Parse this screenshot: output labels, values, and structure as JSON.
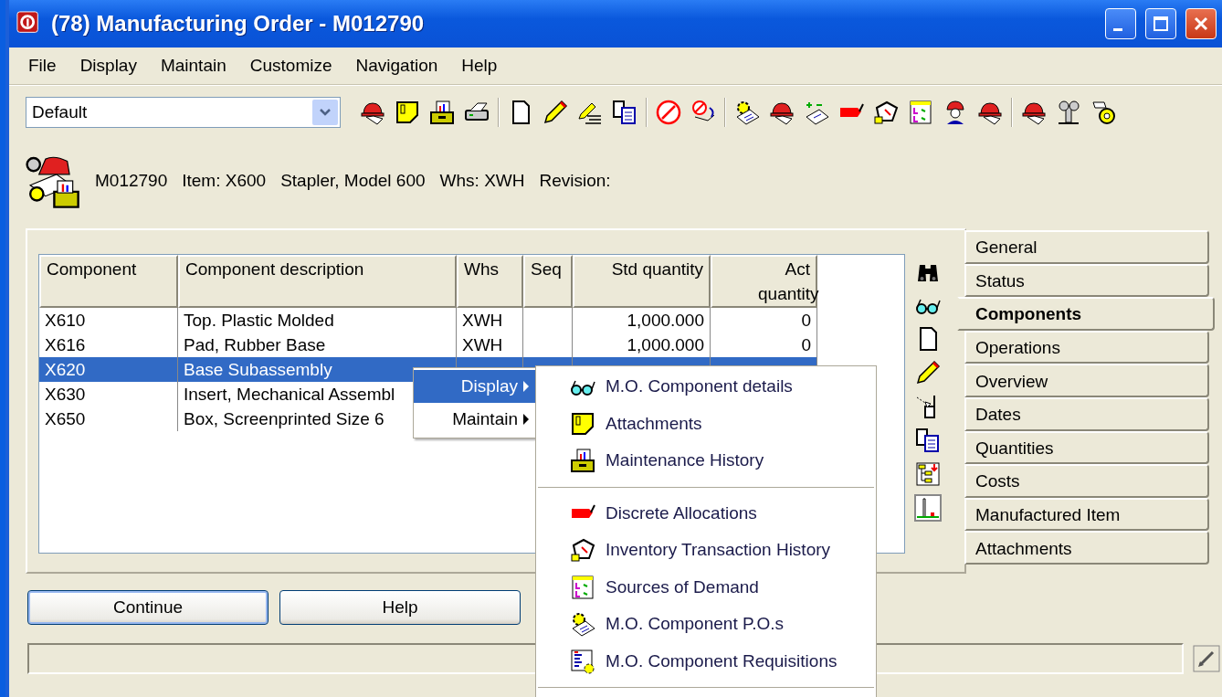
{
  "window": {
    "title": "(78) Manufacturing Order - M012790"
  },
  "menu_bar": [
    "File",
    "Display",
    "Maintain",
    "Customize",
    "Navigation",
    "Help"
  ],
  "view_select": {
    "value": "Default"
  },
  "header": {
    "order": "M012790",
    "item": "Item: X600",
    "description": "Stapler, Model 600",
    "warehouse": "Whs: XWH",
    "revision": "Revision:"
  },
  "table": {
    "columns": [
      "Component",
      "Component description",
      "Whs",
      "Seq",
      "Std quantity",
      "Act quantity"
    ],
    "rows": [
      {
        "cells": [
          "X610",
          "Top. Plastic Molded",
          "XWH",
          "",
          "1,000.000",
          "0"
        ],
        "selected": false
      },
      {
        "cells": [
          "X616",
          "Pad, Rubber Base",
          "XWH",
          "",
          "1,000.000",
          "0"
        ],
        "selected": false
      },
      {
        "cells": [
          "X620",
          "Base Subassembly",
          "",
          "",
          "",
          ""
        ],
        "selected": true
      },
      {
        "cells": [
          "X630",
          "Insert, Mechanical Assembl",
          "",
          "",
          "",
          ""
        ],
        "selected": false
      },
      {
        "cells": [
          "X650",
          "Box, Screenprinted Size 6",
          "",
          "",
          "",
          ""
        ],
        "selected": false
      }
    ]
  },
  "context_menu": {
    "items": [
      {
        "label": "Display",
        "selected": true
      },
      {
        "label": "Maintain",
        "selected": false
      }
    ]
  },
  "submenu": {
    "groups": [
      [
        "M.O. Component details",
        "Attachments",
        "Maintenance History"
      ],
      [
        "Discrete Allocations",
        "Inventory Transaction History",
        "Sources of Demand",
        "M.O. Component P.O.s",
        "M.O. Component Requisitions"
      ]
    ]
  },
  "tabs": [
    {
      "label": "General",
      "selected": false
    },
    {
      "label": "Status",
      "selected": false
    },
    {
      "label": "Components",
      "selected": true
    },
    {
      "label": "Operations",
      "selected": false
    },
    {
      "label": "Overview",
      "selected": false
    },
    {
      "label": "Dates",
      "selected": false
    },
    {
      "label": "Quantities",
      "selected": false
    },
    {
      "label": "Costs",
      "selected": false
    },
    {
      "label": "Manufactured Item",
      "selected": false
    },
    {
      "label": "Attachments",
      "selected": false
    }
  ],
  "buttons": [
    {
      "label": "Continue",
      "focused": true
    },
    {
      "label": "Help",
      "focused": false
    }
  ]
}
